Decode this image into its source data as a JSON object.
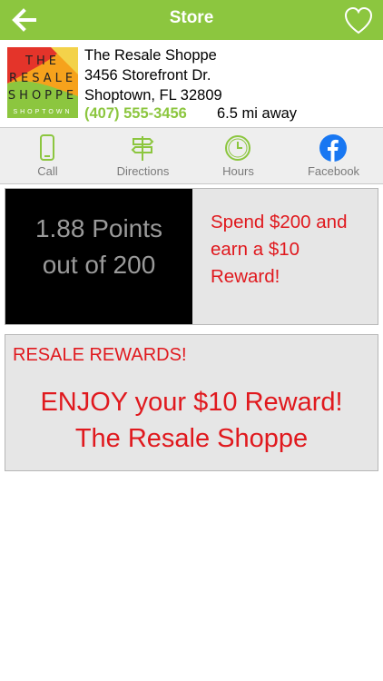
{
  "header": {
    "title": "Store",
    "back_icon": "arrow-left-icon",
    "favorite_icon": "heart-outline-icon"
  },
  "store": {
    "logo_text_line1": "THE",
    "logo_text_line2": "RESALE",
    "logo_text_line3": "SHOPPE",
    "logo_text_line4": "SHOPTOWN",
    "name": "The Resale Shoppe",
    "address_line1": "3456 Storefront Dr.",
    "address_line2": "Shoptown, FL 32809",
    "phone": "(407) 555-3456",
    "distance": "6.5 mi away"
  },
  "actions": [
    {
      "label": "Call",
      "icon": "phone-icon"
    },
    {
      "label": "Directions",
      "icon": "signpost-icon"
    },
    {
      "label": "Hours",
      "icon": "clock-icon"
    },
    {
      "label": "Facebook",
      "icon": "facebook-icon"
    }
  ],
  "points": {
    "line1": "1.88 Points",
    "line2": "out of 200",
    "promo": "Spend $200 and earn a  $10 Reward!"
  },
  "reward": {
    "heading": "RESALE REWARDS!",
    "line1": "ENJOY your $10 Reward!",
    "line2": "The Resale Shoppe"
  },
  "colors": {
    "brand_green": "#8cc63f",
    "alert_red": "#e0191e",
    "facebook_blue": "#1877f2",
    "card_gray": "#e6e6e6"
  }
}
